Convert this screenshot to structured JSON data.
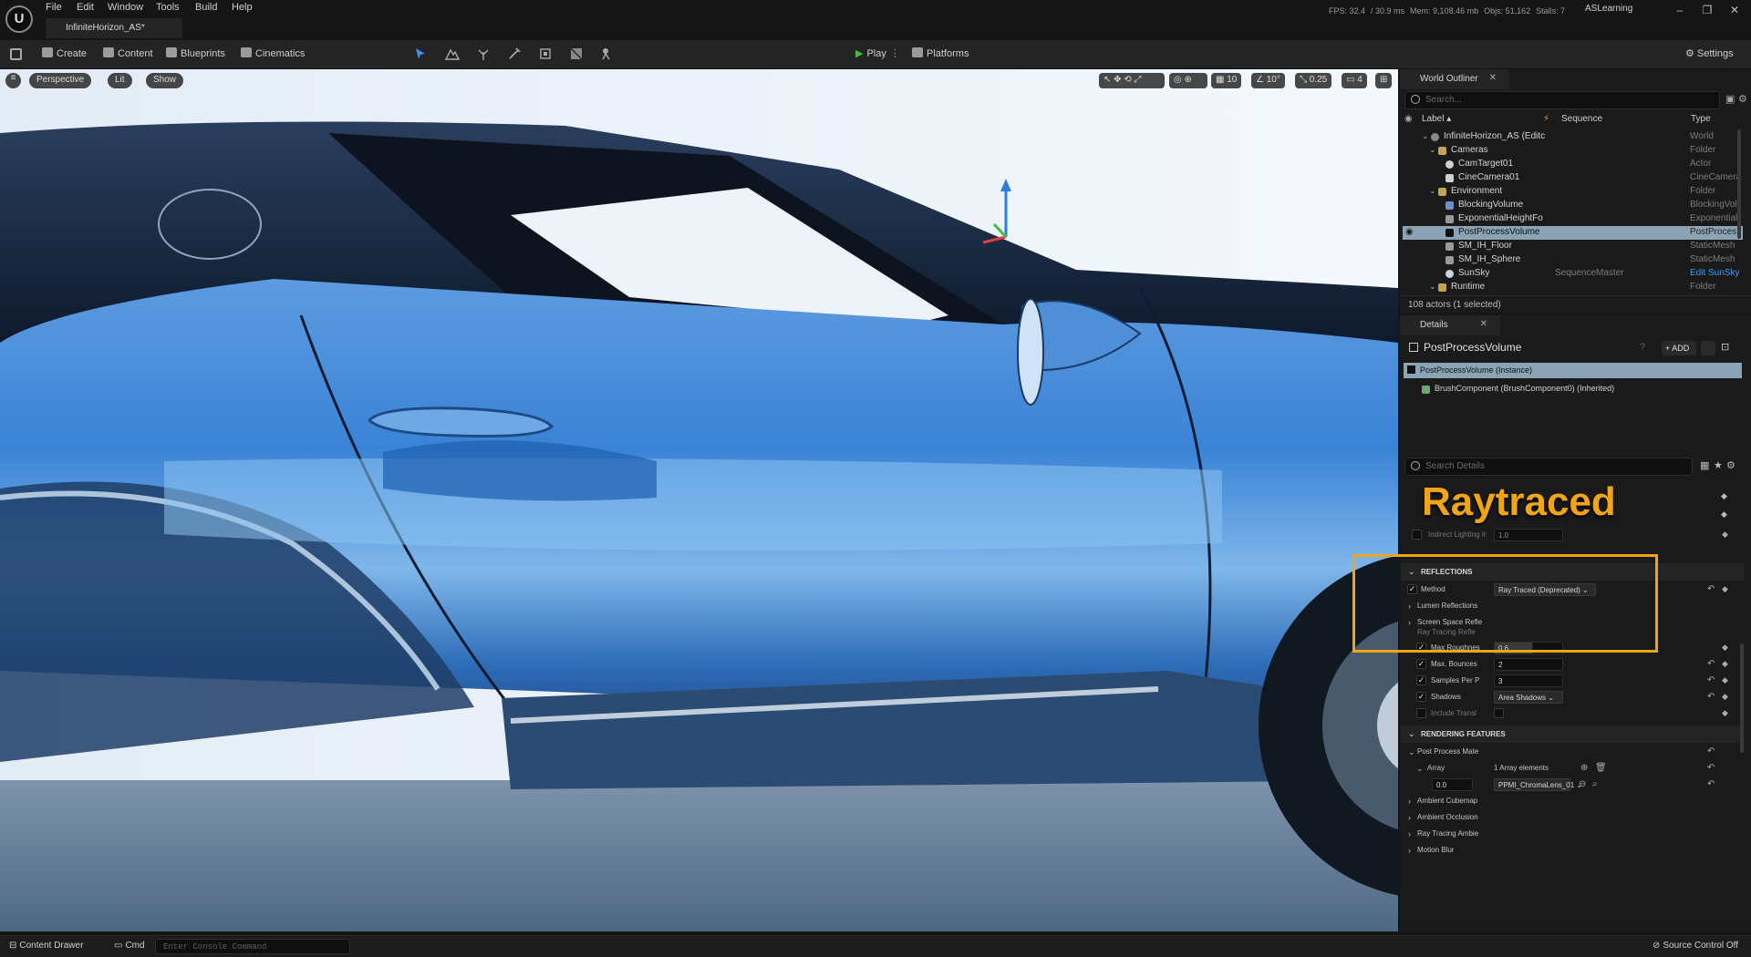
{
  "app": {
    "logo": "U",
    "project_tab": "InfiniteHorizon_AS*"
  },
  "menu": [
    "File",
    "Edit",
    "Window",
    "Tools",
    "Build",
    "Help"
  ],
  "stats": {
    "fps": "FPS: 32.4",
    "ms": "/ 30.9 ms",
    "mem": "Mem: 9,108.46 mb",
    "objs": "Objs: 51,162",
    "stalls": "Stalls: 7"
  },
  "user": "ASLearning",
  "toolbar": {
    "create": "Create",
    "content": "Content",
    "blueprints": "Blueprints",
    "cinematics": "Cinematics",
    "play": "Play",
    "platforms": "Platforms",
    "settings": "Settings"
  },
  "viewport": {
    "perspective": "Perspective",
    "lit": "Lit",
    "show": "Show",
    "grid": "10",
    "angle": "10°",
    "scale": "0.25",
    "cam_speed": "4"
  },
  "outliner": {
    "tab": "World Outliner",
    "search_placeholder": "Search...",
    "col_label": "Label ▴",
    "col_sequence": "Sequence",
    "col_type": "Type",
    "rows": [
      {
        "label": "InfiniteHorizon_AS (Editc",
        "type": "World",
        "icon": "world-icon",
        "seq": ""
      },
      {
        "label": "Cameras",
        "type": "Folder",
        "icon": "folder-icon",
        "seq": ""
      },
      {
        "label": "CamTarget01",
        "type": "Actor",
        "icon": "actor-icon",
        "seq": ""
      },
      {
        "label": "CineCamera01",
        "type": "CineCamera",
        "icon": "camera-icon",
        "seq": ""
      },
      {
        "label": "Environment",
        "type": "Folder",
        "icon": "folder-icon",
        "seq": ""
      },
      {
        "label": "BlockingVolume",
        "type": "BlockingVol",
        "icon": "volume-icon",
        "seq": ""
      },
      {
        "label": "ExponentialHeightFo",
        "type": "Exponential",
        "icon": "fog-icon",
        "seq": ""
      },
      {
        "label": "PostProcessVolume",
        "type": "PostProces",
        "icon": "volume-icon",
        "seq": ""
      },
      {
        "label": "SM_IH_Floor",
        "type": "StaticMesh",
        "icon": "mesh-icon",
        "seq": ""
      },
      {
        "label": "SM_IH_Sphere",
        "type": "StaticMesh",
        "icon": "mesh-icon",
        "seq": ""
      },
      {
        "label": "SunSky",
        "type": "Edit SunSky",
        "icon": "sky-icon",
        "seq": "SequenceMaster"
      },
      {
        "label": "Runtime",
        "type": "Folder",
        "icon": "folder-icon",
        "seq": ""
      }
    ],
    "footer": "108 actors (1 selected)"
  },
  "details": {
    "tab": "Details",
    "actor_name": "PostProcessVolume",
    "add_label": "+ ADD",
    "instance": "PostProcessVolume (Instance)",
    "brush": "BrushComponent (BrushComponent0) (Inherited)",
    "search_placeholder": "Search Details",
    "overlay_text": "Raytraced",
    "indirect": {
      "label": "Indirect Lighting Ir",
      "value": "1.0"
    },
    "reflections": {
      "header": "REFLECTIONS",
      "method_label": "Method",
      "method_value": "Ray Traced (Deprecated)",
      "lumen": "Lumen Reflections",
      "ssr": "Screen Space Refle",
      "rt_header": "Ray Tracing Refle"
    },
    "rt": [
      {
        "label": "Max Roughnes",
        "value": "0.6",
        "kind": "slider"
      },
      {
        "label": "Max. Bounces",
        "value": "2",
        "kind": "field"
      },
      {
        "label": "Samples Per P",
        "value": "3",
        "kind": "field"
      },
      {
        "label": "Shadows",
        "value": "Area Shadows",
        "kind": "dropdown"
      },
      {
        "label": "Include Transl",
        "value": "",
        "kind": "check"
      }
    ],
    "rendering": {
      "header": "RENDERING FEATURES",
      "ppm": "Post Process Mate",
      "array": "Array",
      "array_count": "1 Array elements",
      "elem_weight": "0.0",
      "elem_value": "PPMI_ChromaLens_01"
    },
    "collapsed": [
      "Ambient Cubemap",
      "Ambient Occlusion",
      "Ray Tracing Ambie",
      "Motion Blur"
    ]
  },
  "bottom": {
    "drawer": "Content Drawer",
    "cmd": "Cmd",
    "console_placeholder": "Enter Console Command",
    "source_control": "Source Control Off"
  },
  "colors": {
    "highlight": "#f0a516",
    "selection": "#8aa4b6",
    "accent": "#2f7de0"
  }
}
